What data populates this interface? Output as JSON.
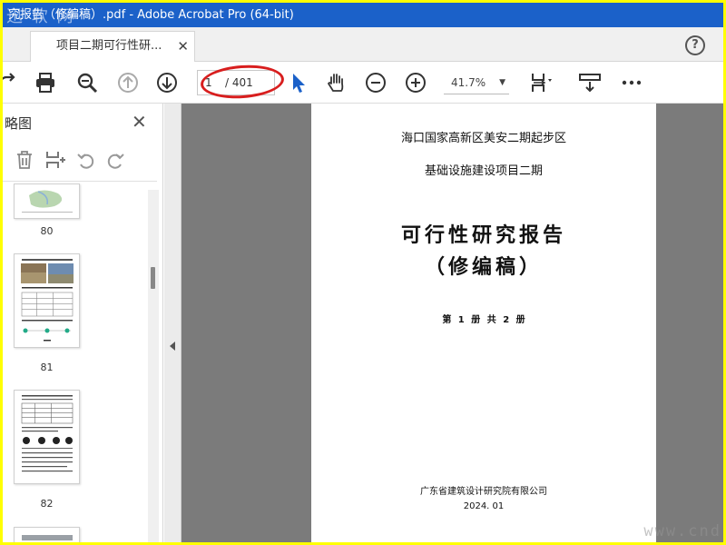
{
  "window": {
    "title": "究报告（修编稿）.pdf - Adobe Acrobat Pro (64-bit)",
    "watermark": "迅 软 网"
  },
  "tab": {
    "label": "项目二期可行性研...",
    "close_glyph": "✕"
  },
  "help": {
    "glyph": "?"
  },
  "toolbar": {
    "page_current": "1",
    "page_total": "/ 401",
    "zoom": "41.7%"
  },
  "sidebar": {
    "title": "略图",
    "close_glyph": "✕",
    "thumbnails": [
      {
        "number": "80"
      },
      {
        "number": "81"
      },
      {
        "number": "82"
      }
    ]
  },
  "document": {
    "line1": "海口国家高新区美安二期起步区",
    "line2": "基础设施建设项目二期",
    "title1": "可行性研究报告",
    "title2": "（修编稿）",
    "volume": "第 1 册  共 2 册",
    "company": "广东省建筑设计研究院有限公司",
    "date": "2024. 01"
  },
  "corner_watermark": "www.cnd",
  "colors": {
    "titlebar": "#1b61c9",
    "frame": "#ffff00",
    "oval": "#d81e1e",
    "select_cursor": "#1b61c9"
  },
  "icons": [
    "share-icon",
    "print-icon",
    "zoom-search-icon",
    "page-up-icon",
    "page-down-icon",
    "select-cursor-icon",
    "hand-icon",
    "zoom-out-icon",
    "zoom-in-icon",
    "fit-page-icon",
    "scroll-mode-icon",
    "more-icon"
  ]
}
